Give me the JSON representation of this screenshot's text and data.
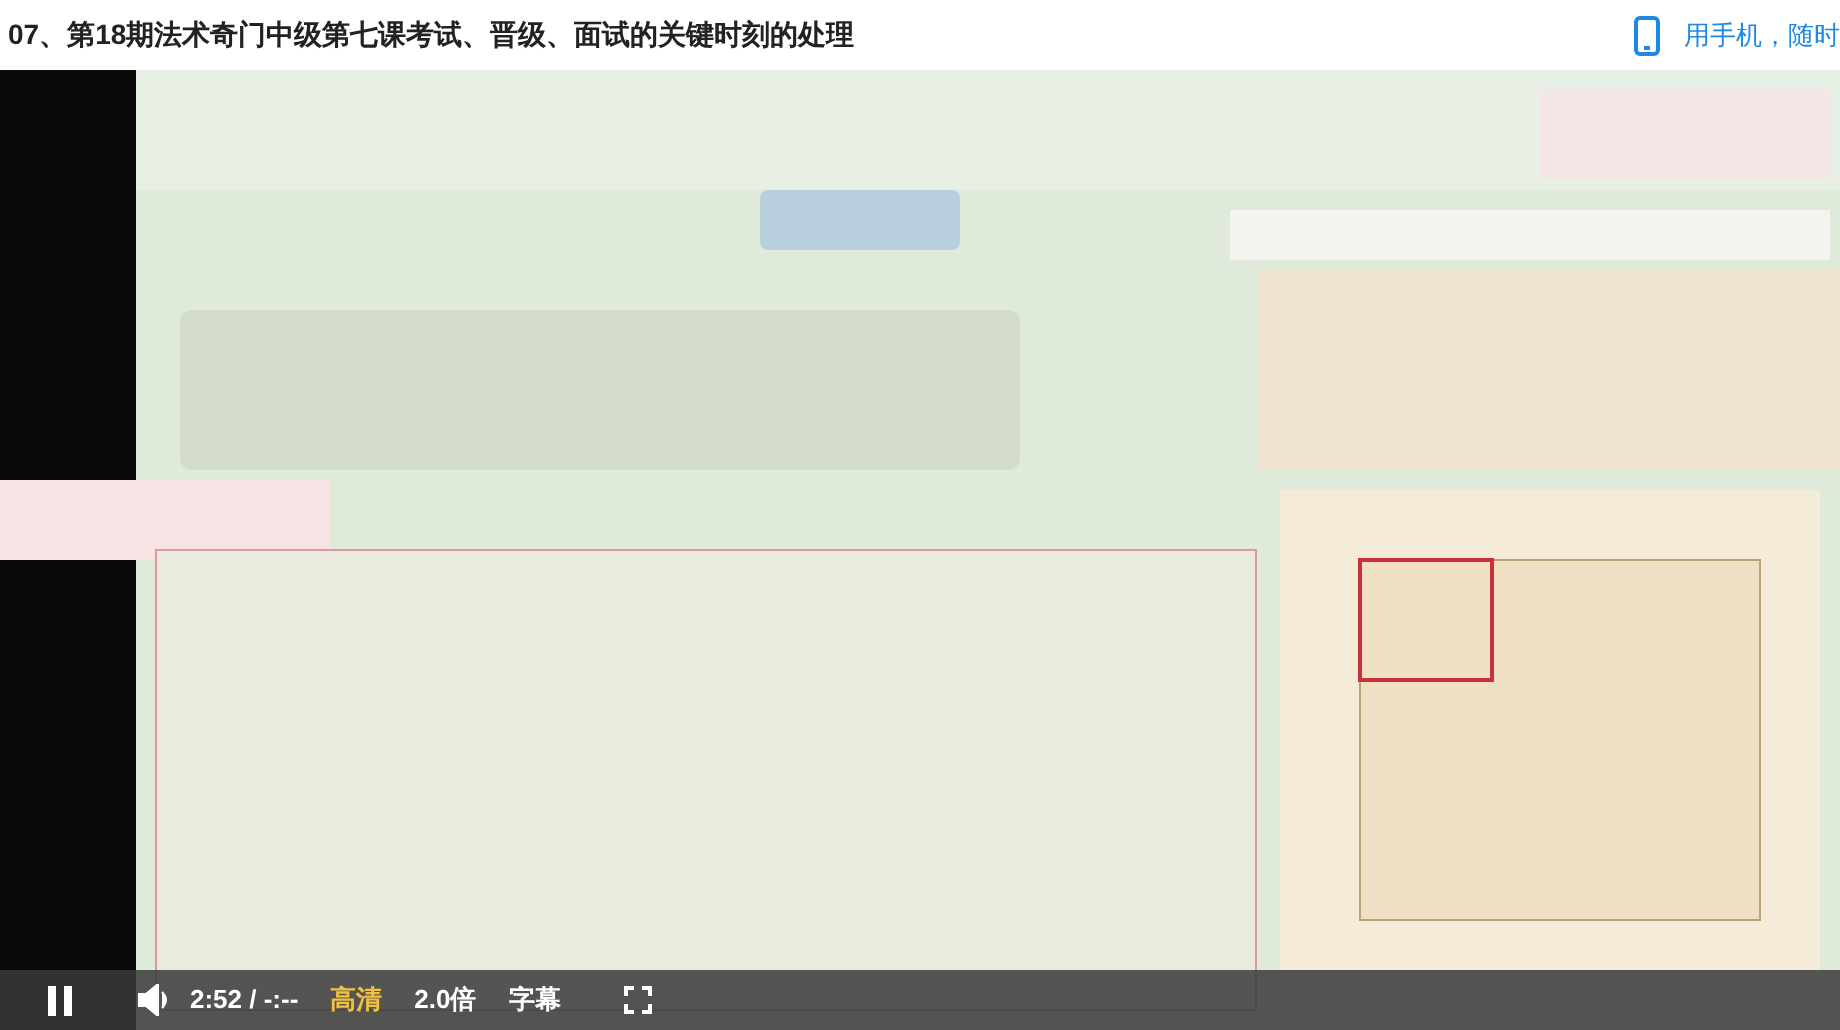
{
  "title": "07、第18期法术奇门中级第七课考试、晋级、面试的关键时刻的处理",
  "mobile_link": "用手机，随时",
  "controls": {
    "playing": true,
    "time": "2:52 / -:--",
    "quality": "高清",
    "speed": "2.0倍",
    "subtitles": "字幕"
  }
}
